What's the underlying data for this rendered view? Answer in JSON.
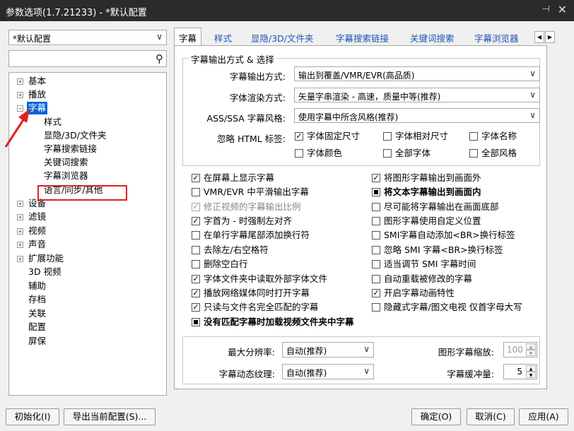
{
  "window": {
    "title": "参数选项(1.7.21233) - *默认配置",
    "pin_glyph": "⊣",
    "close_glyph": "✕"
  },
  "profile": {
    "value": "*默认配置"
  },
  "search": {
    "placeholder": ""
  },
  "tree": {
    "basic": "基本",
    "playback": "播放",
    "subtitle": "字幕",
    "style": "样式",
    "display": "显隐/3D/文件夹",
    "search_link": "字幕搜索链接",
    "keyword": "关键词搜索",
    "browser": "字幕浏览器",
    "language": "语言/同步/其他",
    "device": "设备",
    "filter": "滤镜",
    "video": "视频",
    "audio": "声音",
    "extension": "扩展功能",
    "video3d": "3D 视频",
    "assist": "辅助",
    "storage": "存档",
    "assoc": "关联",
    "config": "配置",
    "screensaver": "屏保"
  },
  "tabs": [
    "字幕",
    "样式",
    "显隐/3D/文件夹",
    "字幕搜索链接",
    "关键词搜索",
    "字幕浏览器"
  ],
  "group": {
    "legend": "字幕输出方式 & 选择",
    "output_label": "字幕输出方式:",
    "output_value": "输出到覆盖/VMR/EVR(高品质)",
    "render_label": "字体渲染方式:",
    "render_value": "矢量字串渲染 - 高速，质量中等(推荐)",
    "ass_label": "ASS/SSA 字幕风格:",
    "ass_value": "使用字幕中所含风格(推荐)",
    "html_label": "忽略 HTML 标签:",
    "html_opts": [
      {
        "label": "字体固定尺寸",
        "checked": true
      },
      {
        "label": "字体相对尺寸",
        "checked": false
      },
      {
        "label": "字体名称",
        "checked": false
      },
      {
        "label": "字体颜色",
        "checked": false
      },
      {
        "label": "全部字体",
        "checked": false
      },
      {
        "label": "全部风格",
        "checked": false
      }
    ]
  },
  "options_left": [
    {
      "label": "在屏幕上显示字幕",
      "state": "checked"
    },
    {
      "label": "VMR/EVR 中平滑输出字幕",
      "state": "unchecked"
    },
    {
      "label": "修正视频的字幕输出比例",
      "state": "disabled-checked"
    },
    {
      "label": "字首为 - 时强制左对齐",
      "state": "checked"
    },
    {
      "label": "在单行字幕尾部添加换行符",
      "state": "unchecked"
    },
    {
      "label": "去除左/右空格符",
      "state": "unchecked"
    },
    {
      "label": "删除空白行",
      "state": "unchecked"
    },
    {
      "label": "字体文件夹中读取外部字体文件",
      "state": "checked"
    },
    {
      "label": "播放网络媒体同时打开字幕",
      "state": "checked"
    },
    {
      "label": "只读与文件名完全匹配的字幕",
      "state": "checked"
    },
    {
      "label": "没有匹配字幕时加载视频文件夹中字幕",
      "state": "indeterminate"
    }
  ],
  "options_right": [
    {
      "label": "将图形字幕输出到画面外",
      "state": "checked"
    },
    {
      "label": "将文本字幕输出到画面内",
      "state": "indeterminate"
    },
    {
      "label": "尽可能将字幕输出在画面底部",
      "state": "unchecked"
    },
    {
      "label": "图形字幕使用自定义位置",
      "state": "unchecked"
    },
    {
      "label": "SMI字幕自动添加<BR>换行标签",
      "state": "unchecked"
    },
    {
      "label": "忽略 SMI 字幕<BR>换行标签",
      "state": "unchecked"
    },
    {
      "label": "适当调节 SMI 字幕时间",
      "state": "unchecked"
    },
    {
      "label": "自动重载被修改的字幕",
      "state": "unchecked"
    },
    {
      "label": "开启字幕动画特性",
      "state": "checked"
    },
    {
      "label": "隐藏式字幕/图文电视 仅首字母大写",
      "state": "unchecked"
    }
  ],
  "bottom_group": {
    "maxres_label": "最大分辨率:",
    "maxres_value": "自动(推荐)",
    "texture_label": "字幕动态纹理:",
    "texture_value": "自动(推荐)",
    "scale_label": "图形字幕缩放:",
    "scale_value": "100",
    "buffer_label": "字幕缓冲量:",
    "buffer_value": "5"
  },
  "buttons": {
    "init": "初始化(I)",
    "export": "导出当前配置(S)...",
    "ok": "确定(O)",
    "cancel": "取消(C)",
    "apply": "应用(A)"
  },
  "colors": {
    "titlebar": "#2b2b2b",
    "selection": "#0a64d6",
    "annotation": "#e02020",
    "tab_link": "#1a55b0"
  }
}
